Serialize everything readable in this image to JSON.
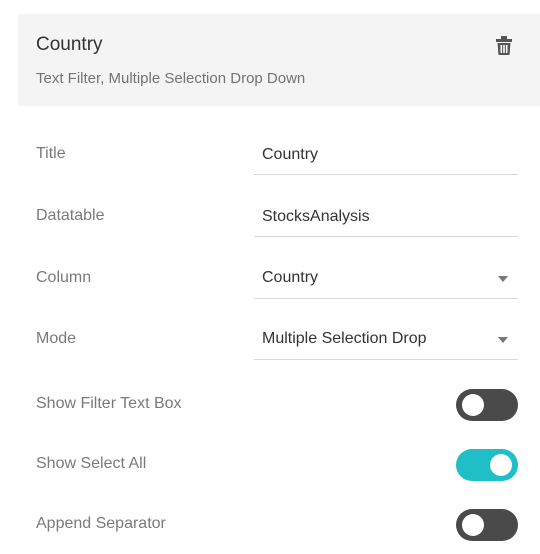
{
  "header": {
    "title": "Country",
    "subtitle": "Text Filter, Multiple Selection Drop Down",
    "delete_icon": "trash-icon"
  },
  "fields": {
    "title": {
      "label": "Title",
      "value": "Country"
    },
    "datatable": {
      "label": "Datatable",
      "value": "StocksAnalysis"
    },
    "column": {
      "label": "Column",
      "value": "Country"
    },
    "mode": {
      "label": "Mode",
      "value": "Multiple Selection Drop"
    }
  },
  "toggles": {
    "show_filter_text_box": {
      "label": "Show Filter Text Box",
      "on": false
    },
    "show_select_all": {
      "label": "Show Select All",
      "on": true
    },
    "append_separator": {
      "label": "Append Separator",
      "on": false
    }
  },
  "colors": {
    "toggle_on": "#20bfc7",
    "toggle_off": "#4a4a4a",
    "header_bg": "#f4f4f4"
  }
}
